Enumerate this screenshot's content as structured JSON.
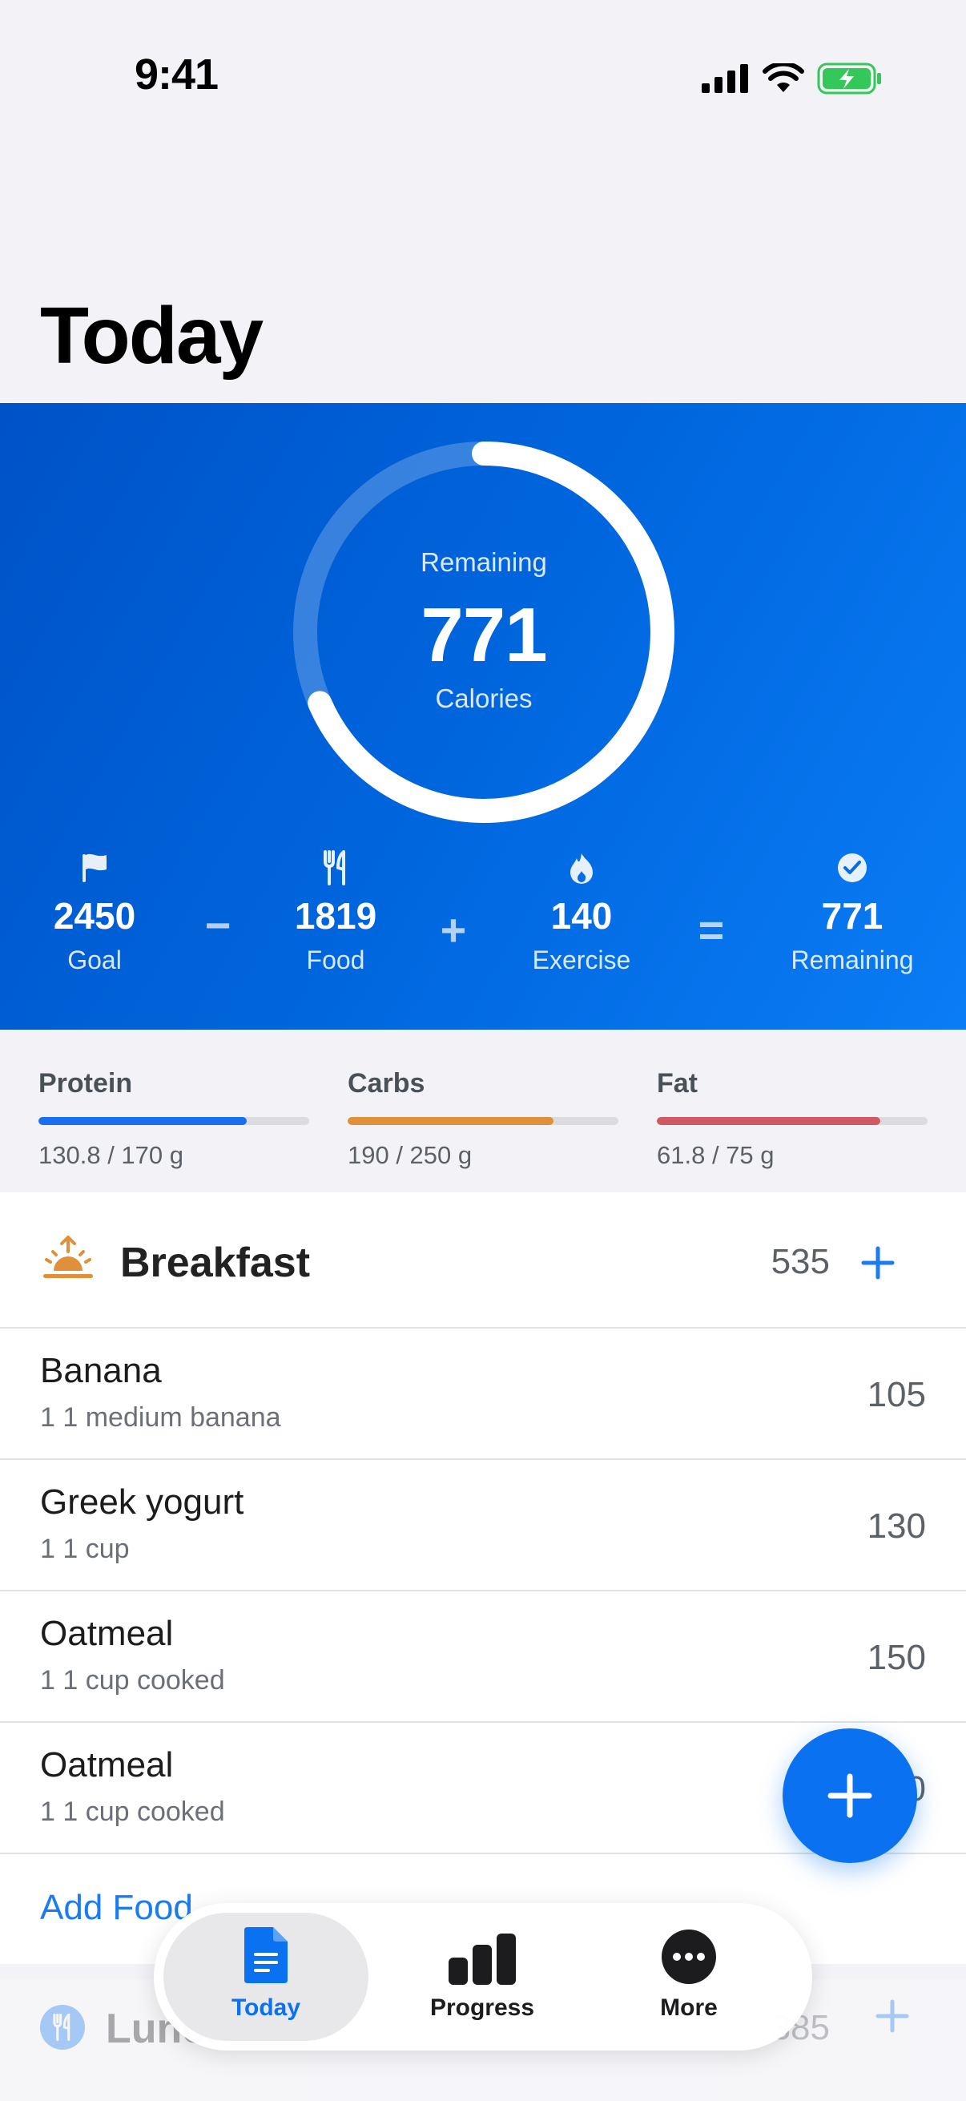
{
  "status_bar": {
    "time": "9:41"
  },
  "page": {
    "title": "Today"
  },
  "calorie_ring": {
    "top_label": "Remaining",
    "value": "771",
    "bottom_label": "Calories",
    "consumed_fraction": 0.685
  },
  "summary": {
    "goal": {
      "value": "2450",
      "label": "Goal",
      "icon": "flag-icon"
    },
    "food": {
      "value": "1819",
      "label": "Food",
      "icon": "fork-knife-icon"
    },
    "exercise": {
      "value": "140",
      "label": "Exercise",
      "icon": "flame-icon"
    },
    "remaining": {
      "value": "771",
      "label": "Remaining",
      "icon": "checkmark-circle-icon"
    },
    "operators": {
      "minus": "−",
      "plus": "+",
      "equals": "="
    }
  },
  "macros": [
    {
      "name": "Protein",
      "amount": "130.8 / 170 g",
      "fraction": 0.77,
      "color": "#1a6ef0"
    },
    {
      "name": "Carbs",
      "amount": "190 / 250 g",
      "fraction": 0.76,
      "color": "#e0903a"
    },
    {
      "name": "Fat",
      "amount": "61.8 / 75 g",
      "fraction": 0.824,
      "color": "#d05a62"
    }
  ],
  "breakfast": {
    "title": "Breakfast",
    "total": "535",
    "icon": "sunrise-icon",
    "items": [
      {
        "name": "Banana",
        "serving": "1 1 medium banana",
        "calories": "105"
      },
      {
        "name": "Greek yogurt",
        "serving": "1 1 cup",
        "calories": "130"
      },
      {
        "name": "Oatmeal",
        "serving": "1 1 cup cooked",
        "calories": "150"
      },
      {
        "name": "Oatmeal",
        "serving": "1 1 cup cooked",
        "calories": "150"
      }
    ],
    "add_food_label": "Add Food"
  },
  "lunch": {
    "title": "Lunch",
    "total": "385"
  },
  "tabs": [
    {
      "label": "Today",
      "icon": "document-icon",
      "active": true
    },
    {
      "label": "Progress",
      "icon": "bar-chart-icon",
      "active": false
    },
    {
      "label": "More",
      "icon": "ellipsis-circle-icon",
      "active": false
    }
  ],
  "colors": {
    "accent": "#0a72f0",
    "hero_start": "#0052c7",
    "hero_end": "#0a7cf5",
    "breakfast_icon": "#e0903a"
  }
}
